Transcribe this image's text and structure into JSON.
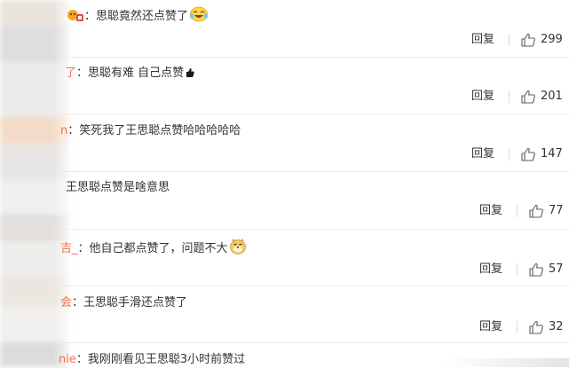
{
  "comments": [
    {
      "user_fragment": "",
      "separator": "：",
      "text": "思聪竟然还点赞了",
      "emoji": "laugh-cry-emoji",
      "reply_label": "回复",
      "likes": "299",
      "has_badge": true
    },
    {
      "user_fragment": "了",
      "separator": "：",
      "text": "思聪有难  自己点赞",
      "emoji": "thumb-emoji",
      "reply_label": "回复",
      "likes": "201"
    },
    {
      "user_fragment": "n",
      "separator": "：",
      "text": "笑死我了王思聪点赞哈哈哈哈哈",
      "reply_label": "回复",
      "likes": "147"
    },
    {
      "user_fragment": "",
      "separator": "：",
      "text": "王思聪点赞是啥意思",
      "reply_label": "回复",
      "likes": "77"
    },
    {
      "user_fragment": "吉_",
      "separator": "：",
      "text": "他自己都点赞了，问题不大",
      "emoji": "doge-emoji",
      "reply_label": "回复",
      "likes": "57"
    },
    {
      "user_fragment": "会",
      "separator": "：",
      "text": "王思聪手滑还点赞了",
      "reply_label": "回复",
      "likes": "32"
    },
    {
      "user_fragment": "nie",
      "separator": "：",
      "text": "我刚刚看见王思聪3小时前赞过",
      "reply_label": "",
      "likes": ""
    }
  ],
  "colors": {
    "username": "#eb7350",
    "text": "#333333",
    "divider": "#ececec"
  }
}
